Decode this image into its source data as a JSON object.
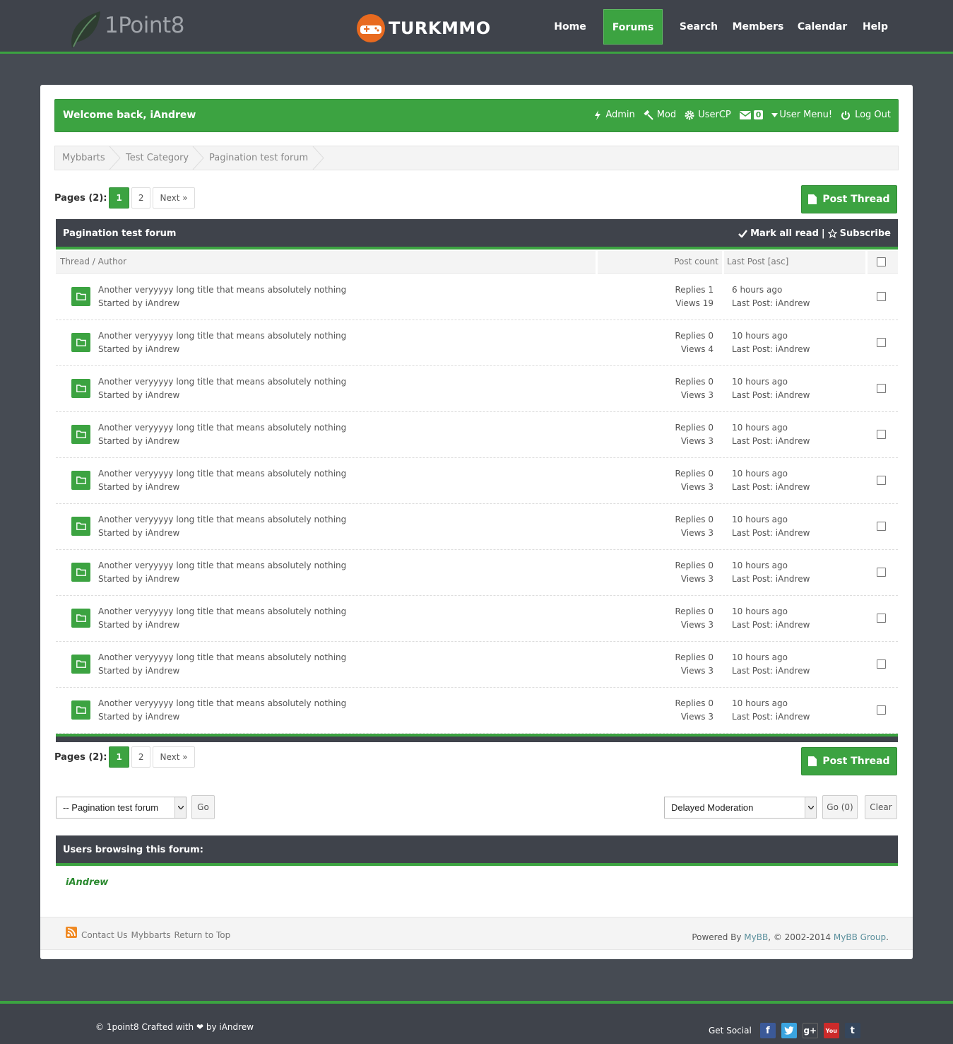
{
  "header": {
    "logo_text": "1Point8",
    "brand_text": "TURKMMO",
    "nav": [
      {
        "label": "Home",
        "active": false
      },
      {
        "label": "Forums",
        "active": true
      },
      {
        "label": "Search",
        "active": false
      },
      {
        "label": "Members",
        "active": false
      },
      {
        "label": "Calendar",
        "active": false
      },
      {
        "label": "Help",
        "active": false
      }
    ]
  },
  "welcome": {
    "text": "Welcome back, iAndrew",
    "admin": "Admin",
    "mod": "Mod",
    "usercp": "UserCP",
    "pm_count": "0",
    "user_menu": "User Menu!",
    "logout": "Log Out"
  },
  "breadcrumb": [
    "Mybbarts",
    "Test Category",
    "Pagination test forum"
  ],
  "pagination": {
    "label": "Pages (2):",
    "current": "1",
    "other": "2",
    "next": "Next »"
  },
  "post_thread_label": "Post Thread",
  "forum": {
    "title": "Pagination test forum",
    "mark_all_read": "Mark all read",
    "separator": "|",
    "subscribe": "Subscribe",
    "columns": {
      "thread": "Thread / Author",
      "post_count": "Post count",
      "last_post": "Last Post [asc]"
    }
  },
  "threads": [
    {
      "title": "Another veryyyyy long title that means absolutely nothing",
      "author": "Started by iAndrew",
      "replies": "Replies 1",
      "views": "Views 19",
      "time": "6 hours ago",
      "last_by": "Last Post: iAndrew"
    },
    {
      "title": "Another veryyyyy long title that means absolutely nothing",
      "author": "Started by iAndrew",
      "replies": "Replies 0",
      "views": "Views 4",
      "time": "10 hours ago",
      "last_by": "Last Post: iAndrew"
    },
    {
      "title": "Another veryyyyy long title that means absolutely nothing",
      "author": "Started by iAndrew",
      "replies": "Replies 0",
      "views": "Views 3",
      "time": "10 hours ago",
      "last_by": "Last Post: iAndrew"
    },
    {
      "title": "Another veryyyyy long title that means absolutely nothing",
      "author": "Started by iAndrew",
      "replies": "Replies 0",
      "views": "Views 3",
      "time": "10 hours ago",
      "last_by": "Last Post: iAndrew"
    },
    {
      "title": "Another veryyyyy long title that means absolutely nothing",
      "author": "Started by iAndrew",
      "replies": "Replies 0",
      "views": "Views 3",
      "time": "10 hours ago",
      "last_by": "Last Post: iAndrew"
    },
    {
      "title": "Another veryyyyy long title that means absolutely nothing",
      "author": "Started by iAndrew",
      "replies": "Replies 0",
      "views": "Views 3",
      "time": "10 hours ago",
      "last_by": "Last Post: iAndrew"
    },
    {
      "title": "Another veryyyyy long title that means absolutely nothing",
      "author": "Started by iAndrew",
      "replies": "Replies 0",
      "views": "Views 3",
      "time": "10 hours ago",
      "last_by": "Last Post: iAndrew"
    },
    {
      "title": "Another veryyyyy long title that means absolutely nothing",
      "author": "Started by iAndrew",
      "replies": "Replies 0",
      "views": "Views 3",
      "time": "10 hours ago",
      "last_by": "Last Post: iAndrew"
    },
    {
      "title": "Another veryyyyy long title that means absolutely nothing",
      "author": "Started by iAndrew",
      "replies": "Replies 0",
      "views": "Views 3",
      "time": "10 hours ago",
      "last_by": "Last Post: iAndrew"
    },
    {
      "title": "Another veryyyyy long title that means absolutely nothing",
      "author": "Started by iAndrew",
      "replies": "Replies 0",
      "views": "Views 3",
      "time": "10 hours ago",
      "last_by": "Last Post: iAndrew"
    }
  ],
  "forum_jump": {
    "selected": "-- Pagination test forum",
    "go": "Go"
  },
  "moderation": {
    "selected": "Delayed Moderation",
    "go": "Go (0)",
    "clear": "Clear"
  },
  "users_browsing": {
    "title": "Users browsing this forum:",
    "users": "iAndrew"
  },
  "footer": {
    "links": [
      "Contact Us",
      "Mybbarts",
      "Return to Top"
    ],
    "powered_prefix": "Powered By ",
    "powered_mybb": "MyBB",
    "powered_mid": ", © 2002-2014 ",
    "powered_group": "MyBB Group",
    "powered_end": "."
  },
  "bottom": {
    "copyright": "© 1point8 Crafted with ❤ by iAndrew",
    "get_social": "Get Social",
    "social_icons": [
      "facebook-icon",
      "twitter-icon",
      "google-plus-icon",
      "youtube-icon",
      "tumblr-icon"
    ]
  },
  "colors": {
    "accent": "#3ca341",
    "dark": "#3f434b",
    "background": "#464b53"
  }
}
